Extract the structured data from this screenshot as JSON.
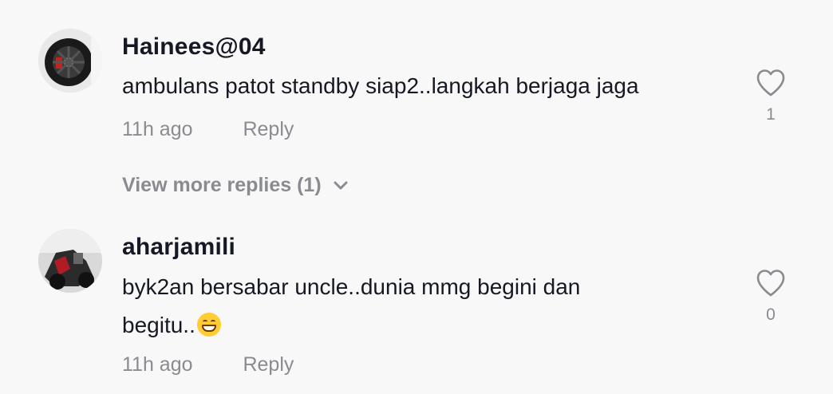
{
  "comments": [
    {
      "username": "Hainees@04",
      "text": "ambulans patot standby siap2..langkah berjaga jaga",
      "time": "11h ago",
      "reply_label": "Reply",
      "likes": "1"
    },
    {
      "username": "aharjamili",
      "text_line1": "byk2an bersabar uncle..dunia mmg begini dan",
      "text_line2": "begitu..",
      "emoji": "grinning-face-emoji",
      "time": "11h ago",
      "reply_label": "Reply",
      "likes": "0"
    }
  ],
  "view_more": {
    "label": "View more replies (1)",
    "icon": "chevron-down-icon"
  },
  "colors": {
    "background": "#f8f8f8",
    "text_primary": "#161823",
    "text_secondary": "#8a8b91"
  }
}
